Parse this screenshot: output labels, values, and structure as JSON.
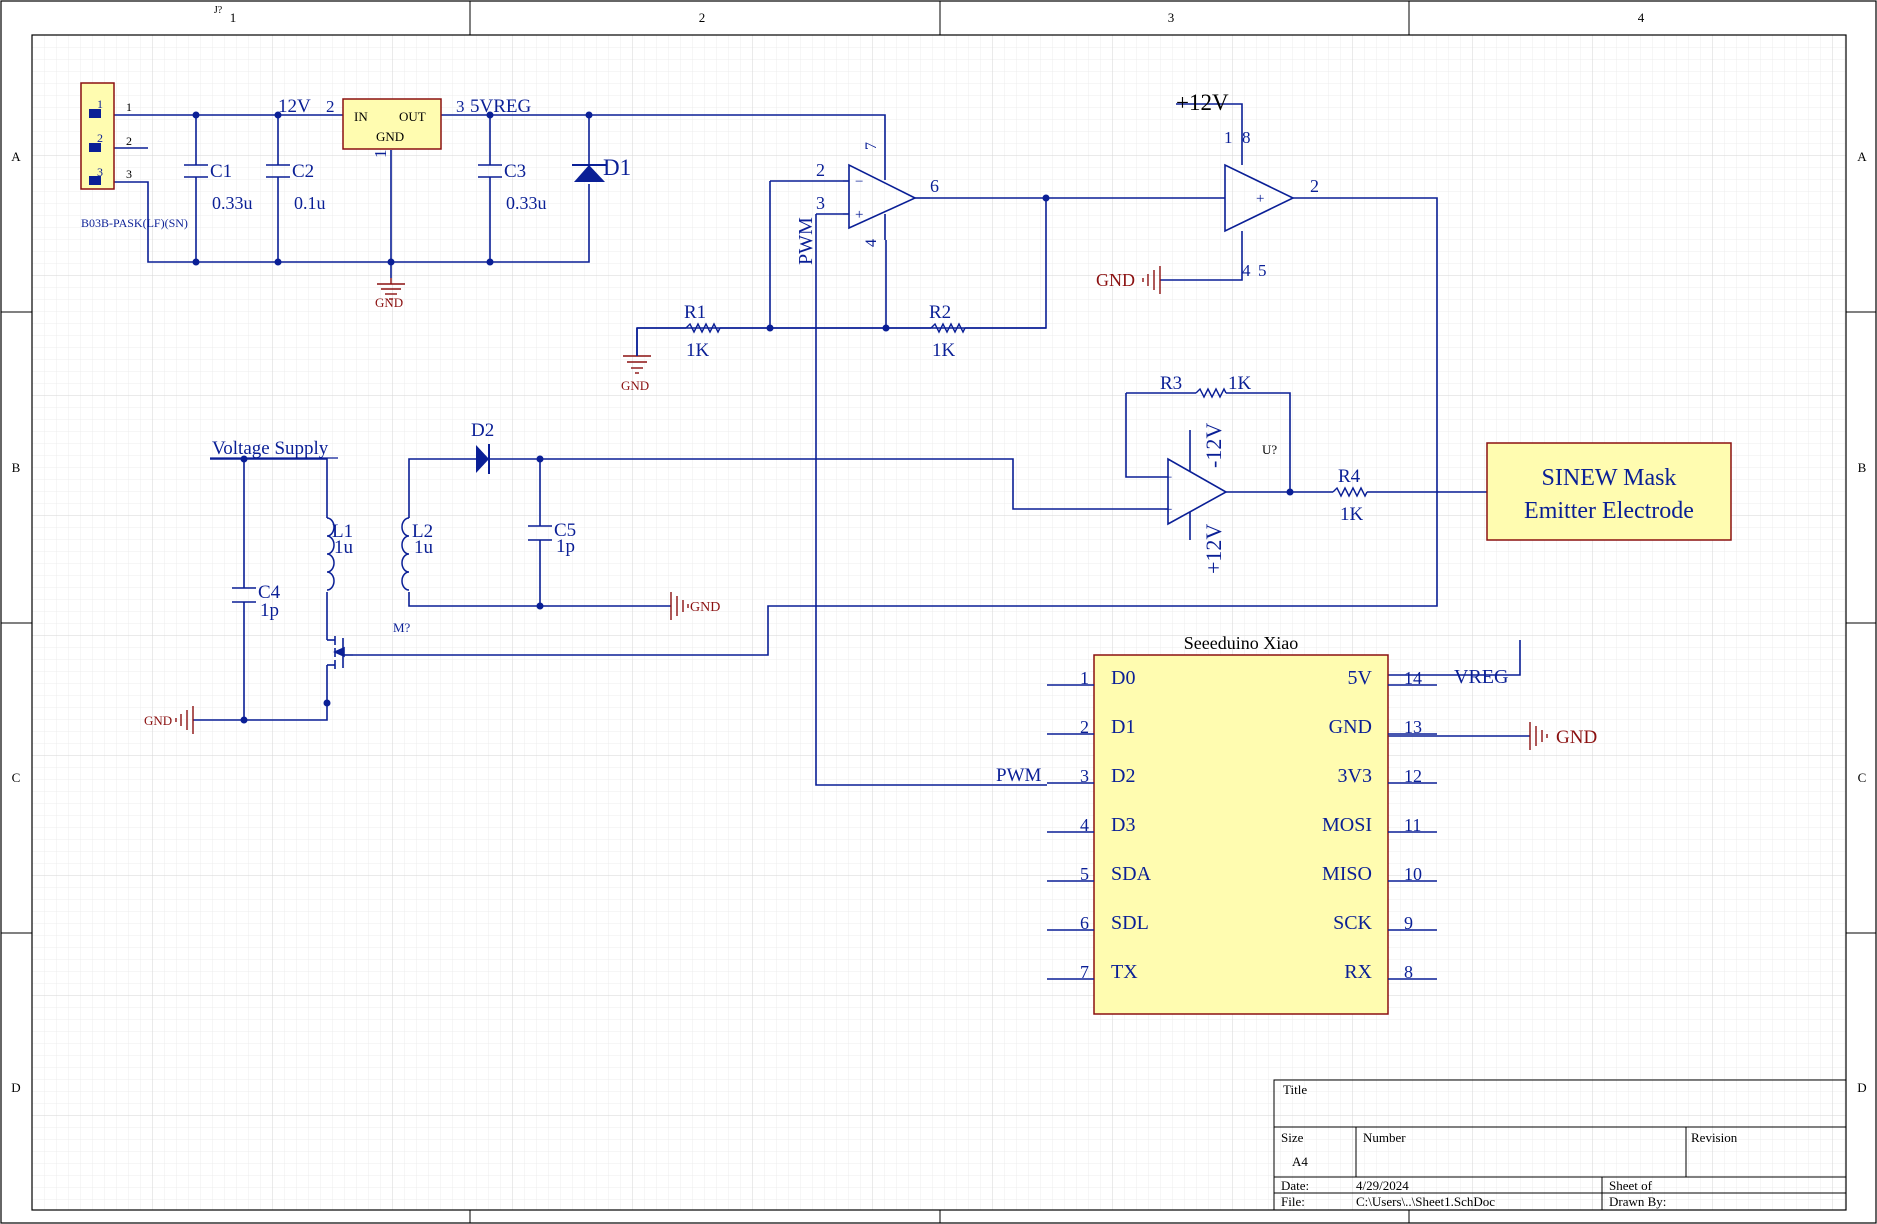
{
  "colors": {
    "wire": "#0a1f96",
    "power_port": "#8b1010",
    "part_fill": "#fffcb0",
    "part_stroke": "#8b1010",
    "pin_label": "#0a1f96",
    "frame": "#000000",
    "grid": "#dcdcdc"
  },
  "frame": {
    "top_ref": "J?",
    "columns": [
      "1",
      "2",
      "3",
      "4"
    ],
    "rows": [
      "A",
      "B",
      "C",
      "D"
    ]
  },
  "title_block": {
    "title_label": "Title",
    "size_label": "Size",
    "size_value": "A4",
    "number_label": "Number",
    "revision_label": "Revision",
    "date_label": "Date:",
    "date_value": "4/29/2024",
    "file_label": "File:",
    "file_value": "C:\\Users\\..\\Sheet1.SchDoc",
    "sheet_label": "Sheet  of",
    "drawn_label": "Drawn By:"
  },
  "connector": {
    "pins": [
      "1",
      "2",
      "3"
    ],
    "part_name": "B03B-PASK(LF)(SN)"
  },
  "regulator": {
    "in": "IN",
    "out": "OUT",
    "gnd": "GND",
    "pin_in": "2",
    "pin_out": "3",
    "pin_gnd": "1"
  },
  "nets": {
    "n12v": "12V",
    "vreg": "5VREG",
    "gnd": "GND",
    "pwm": "PWM",
    "p12": "+12V",
    "m12": "-12V",
    "vreg_port": "VREG",
    "voltage_supply": "Voltage Supply"
  },
  "components": {
    "c1": {
      "ref": "C1",
      "val": "0.33u"
    },
    "c2": {
      "ref": "C2",
      "val": "0.1u"
    },
    "c3": {
      "ref": "C3",
      "val": "0.33u"
    },
    "c4": {
      "ref": "C4",
      "val": "1p"
    },
    "c5": {
      "ref": "C5",
      "val": "1p"
    },
    "d1": {
      "ref": "D1"
    },
    "d2": {
      "ref": "D2"
    },
    "r1": {
      "ref": "R1",
      "val": "1K"
    },
    "r2": {
      "ref": "R2",
      "val": "1K"
    },
    "r3": {
      "ref": "R3",
      "val": "1K"
    },
    "r4": {
      "ref": "R4",
      "val": "1K"
    },
    "l1": {
      "ref": "L1",
      "val": "1u"
    },
    "l2": {
      "ref": "L2",
      "val": "1u"
    },
    "mosfet": {
      "ref": "M?"
    },
    "u3": {
      "ref": "U?"
    }
  },
  "opamp1": {
    "minus_pin": "2",
    "plus_pin": "3",
    "out_pin": "6",
    "vpos_pin": "7",
    "vneg_pin": "4",
    "minus": "−",
    "plus": "+"
  },
  "opamp2": {
    "plus": "+",
    "out_pin": "2",
    "pin1": "1",
    "pin8": "8",
    "pin4": "4",
    "pin5": "5"
  },
  "opamp3": {
    "minus": "−",
    "plus": "+"
  },
  "output_block": {
    "line1": "SINEW Mask",
    "line2": "Emitter Electrode"
  },
  "mcu": {
    "name": "Seeeduino Xiao",
    "left_pins": [
      {
        "num": "1",
        "label": "D0"
      },
      {
        "num": "2",
        "label": "D1"
      },
      {
        "num": "3",
        "label": "D2"
      },
      {
        "num": "4",
        "label": "D3"
      },
      {
        "num": "5",
        "label": "SDA"
      },
      {
        "num": "6",
        "label": "SDL"
      },
      {
        "num": "7",
        "label": "TX"
      }
    ],
    "right_pins": [
      {
        "num": "14",
        "label": "5V"
      },
      {
        "num": "13",
        "label": "GND"
      },
      {
        "num": "12",
        "label": "3V3"
      },
      {
        "num": "11",
        "label": "MOSI"
      },
      {
        "num": "10",
        "label": "MISO"
      },
      {
        "num": "9",
        "label": "SCK"
      },
      {
        "num": "8",
        "label": "RX"
      }
    ]
  }
}
